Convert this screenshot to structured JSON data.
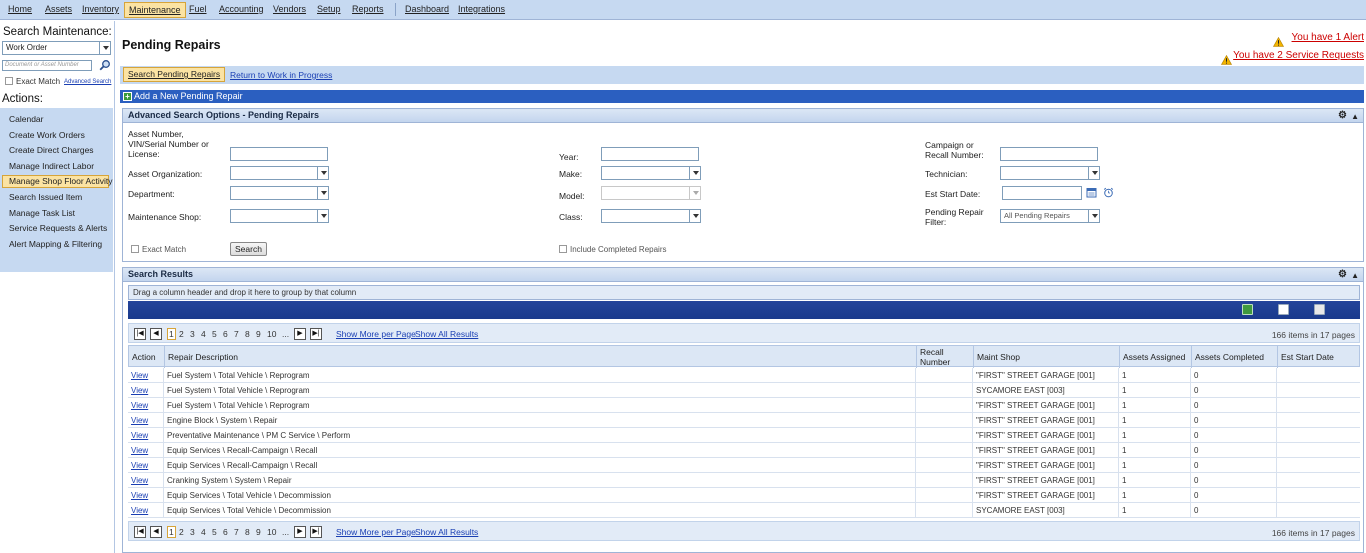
{
  "nav": {
    "items": [
      "Home",
      "Assets",
      "Inventory",
      "Maintenance",
      "Fuel",
      "Accounting",
      "Vendors",
      "Setup",
      "Reports",
      "Dashboard",
      "Integrations"
    ],
    "active": "Maintenance"
  },
  "sidebar": {
    "search_title": "Search Maintenance:",
    "search_type": "Work Order",
    "search_placeholder": "Document or Asset Number",
    "exact_match": "Exact Match",
    "advanced_search": "Advanced Search",
    "actions_title": "Actions:",
    "actions": [
      "Calendar",
      "Create Work Orders",
      "Create Direct Charges",
      "Manage Indirect Labor",
      "Manage Shop Floor Activity",
      "Search Issued Item",
      "Manage Task List",
      "Service Requests & Alerts",
      "Alert Mapping & Filtering"
    ],
    "active_action": "Manage Shop Floor Activity"
  },
  "header": {
    "title": "Pending Repairs",
    "alert_text": "You have 1 Alert",
    "service_text": "You have 2 Service Requests"
  },
  "tabs": {
    "active": "Search Pending Repairs",
    "link": "Return to Work in Progress"
  },
  "add_new": "Add a New Pending Repair",
  "advanced": {
    "title": "Advanced Search Options - Pending Repairs",
    "labels": {
      "asset_number": "Asset Number, VIN/Serial Number or License:",
      "asset_org": "Asset Organization:",
      "department": "Department:",
      "maint_shop": "Maintenance Shop:",
      "year": "Year:",
      "make": "Make:",
      "model": "Model:",
      "class": "Class:",
      "campaign": "Campaign or Recall Number:",
      "technician": "Technician:",
      "est_start": "Est Start Date:",
      "pending_filter": "Pending Repair Filter:"
    },
    "pending_filter_value": "All Pending Repairs",
    "exact_match": "Exact Match",
    "search_button": "Search",
    "include_completed": "Include Completed Repairs"
  },
  "results": {
    "title": "Search Results",
    "group_hint": "Drag a column header and drop it here to group by that column",
    "pages": [
      "1",
      "2",
      "3",
      "4",
      "5",
      "6",
      "7",
      "8",
      "9",
      "10",
      "..."
    ],
    "current_page": "1",
    "show_more": "Show More per Page",
    "show_all": "Show All Results",
    "info": "166 items in 17 pages",
    "columns": [
      "Action",
      "Repair Description",
      "Recall Number",
      "Maint Shop",
      "Assets Assigned",
      "Assets Completed",
      "Est Start Date"
    ],
    "rows": [
      [
        "View",
        "Fuel System \\ Total Vehicle \\ Reprogram",
        "",
        "\"FIRST\" STREET GARAGE [001]",
        "1",
        "0",
        ""
      ],
      [
        "View",
        "Fuel System \\ Total Vehicle \\ Reprogram",
        "",
        "SYCAMORE EAST [003]",
        "1",
        "0",
        ""
      ],
      [
        "View",
        "Fuel System \\ Total Vehicle \\ Reprogram",
        "",
        "\"FIRST\" STREET GARAGE [001]",
        "1",
        "0",
        ""
      ],
      [
        "View",
        "Engine Block \\ System \\ Repair",
        "",
        "\"FIRST\" STREET GARAGE [001]",
        "1",
        "0",
        ""
      ],
      [
        "View",
        "Preventative Maintenance \\ PM C Service \\ Perform",
        "",
        "\"FIRST\" STREET GARAGE [001]",
        "1",
        "0",
        ""
      ],
      [
        "View",
        "Equip Services \\ Recall-Campaign \\ Recall",
        "",
        "\"FIRST\" STREET GARAGE [001]",
        "1",
        "0",
        ""
      ],
      [
        "View",
        "Equip Services \\ Recall-Campaign \\ Recall",
        "",
        "\"FIRST\" STREET GARAGE [001]",
        "1",
        "0",
        ""
      ],
      [
        "View",
        "Cranking System \\ System \\ Repair",
        "",
        "\"FIRST\" STREET GARAGE [001]",
        "1",
        "0",
        ""
      ],
      [
        "View",
        "Equip Services \\ Total Vehicle \\ Decommission",
        "",
        "\"FIRST\" STREET GARAGE [001]",
        "1",
        "0",
        ""
      ],
      [
        "View",
        "Equip Services \\ Total Vehicle \\ Decommission",
        "",
        "SYCAMORE EAST [003]",
        "1",
        "0",
        ""
      ]
    ]
  },
  "colors": {
    "nav_bg": "#c6d9f1",
    "active_bg": "#fbe3a3",
    "add_bar": "#2b5fc0",
    "alert": "#cc0000"
  }
}
